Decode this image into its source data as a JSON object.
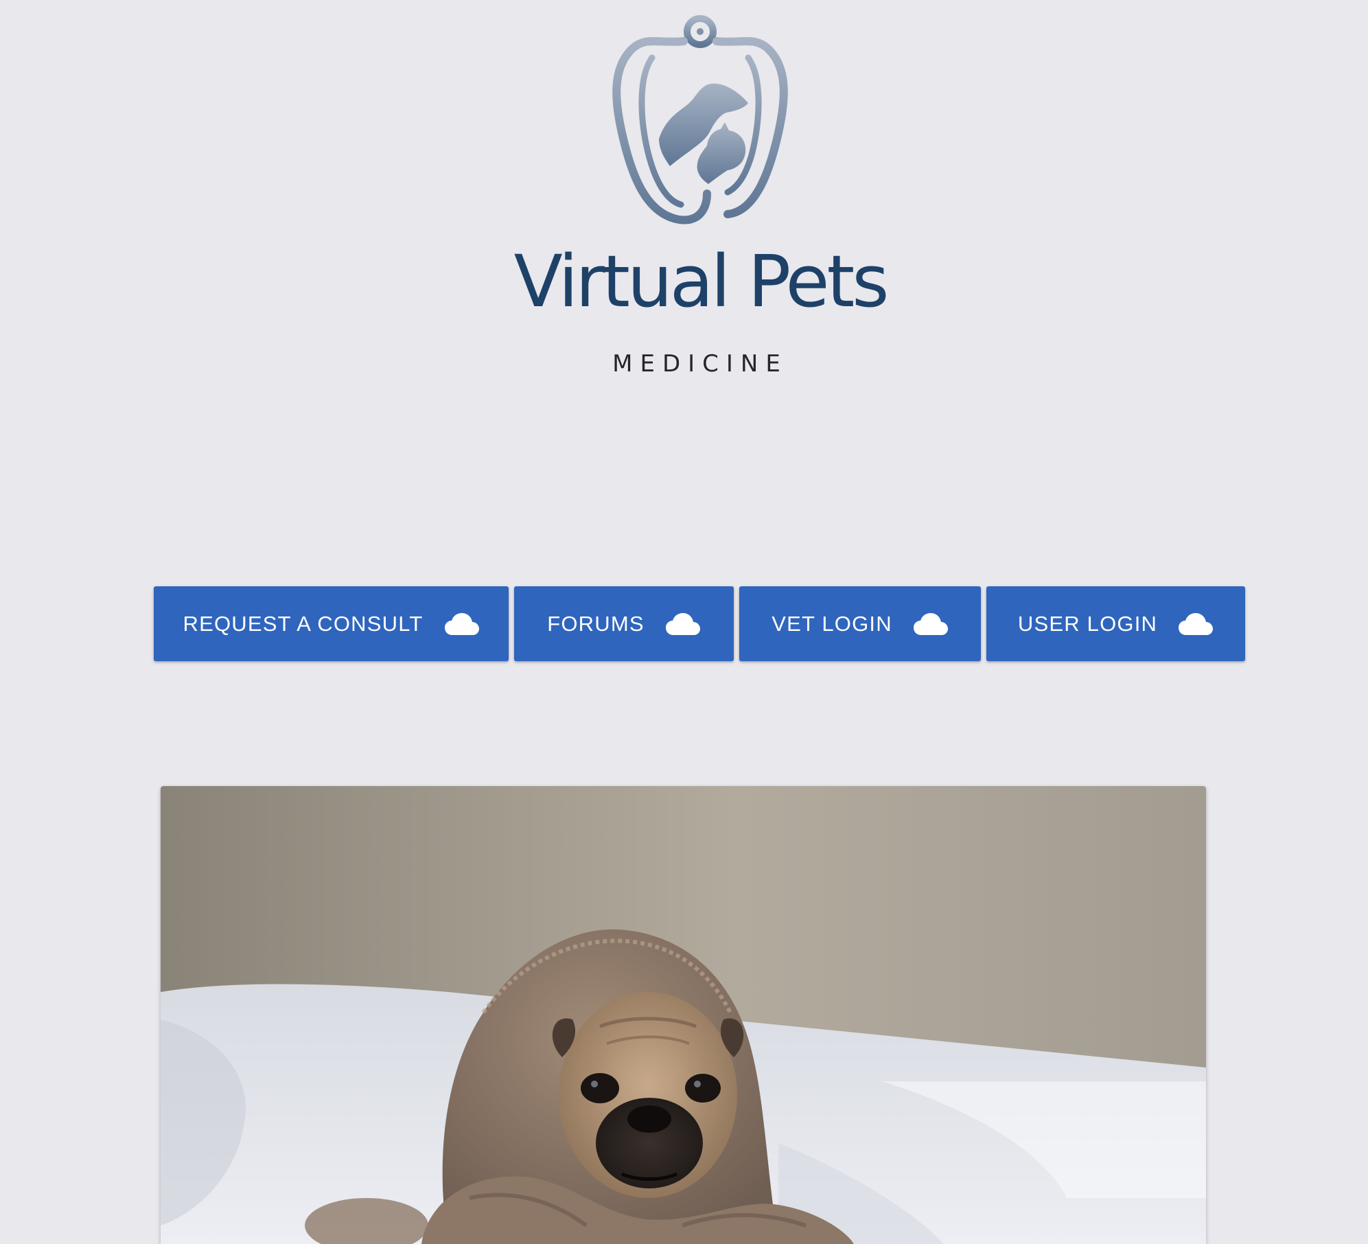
{
  "logo": {
    "title": "Virtual Pets",
    "subtitle": "MEDICINE",
    "icon": "stethoscope-pets-logo-icon"
  },
  "nav": {
    "buttons": [
      {
        "label": "REQUEST A CONSULT",
        "icon": "cloud-icon"
      },
      {
        "label": "FORUMS",
        "icon": "cloud-icon"
      },
      {
        "label": "VET LOGIN",
        "icon": "cloud-icon"
      },
      {
        "label": "USER LOGIN",
        "icon": "cloud-icon"
      }
    ]
  },
  "hero": {
    "subject": "pug-in-blanket-photo"
  },
  "colors": {
    "background": "#e8e8ed",
    "button": "#2f65bd",
    "button_text": "#ffffff",
    "logo_text": "#1e4168",
    "logo_subtitle": "#25252b"
  }
}
